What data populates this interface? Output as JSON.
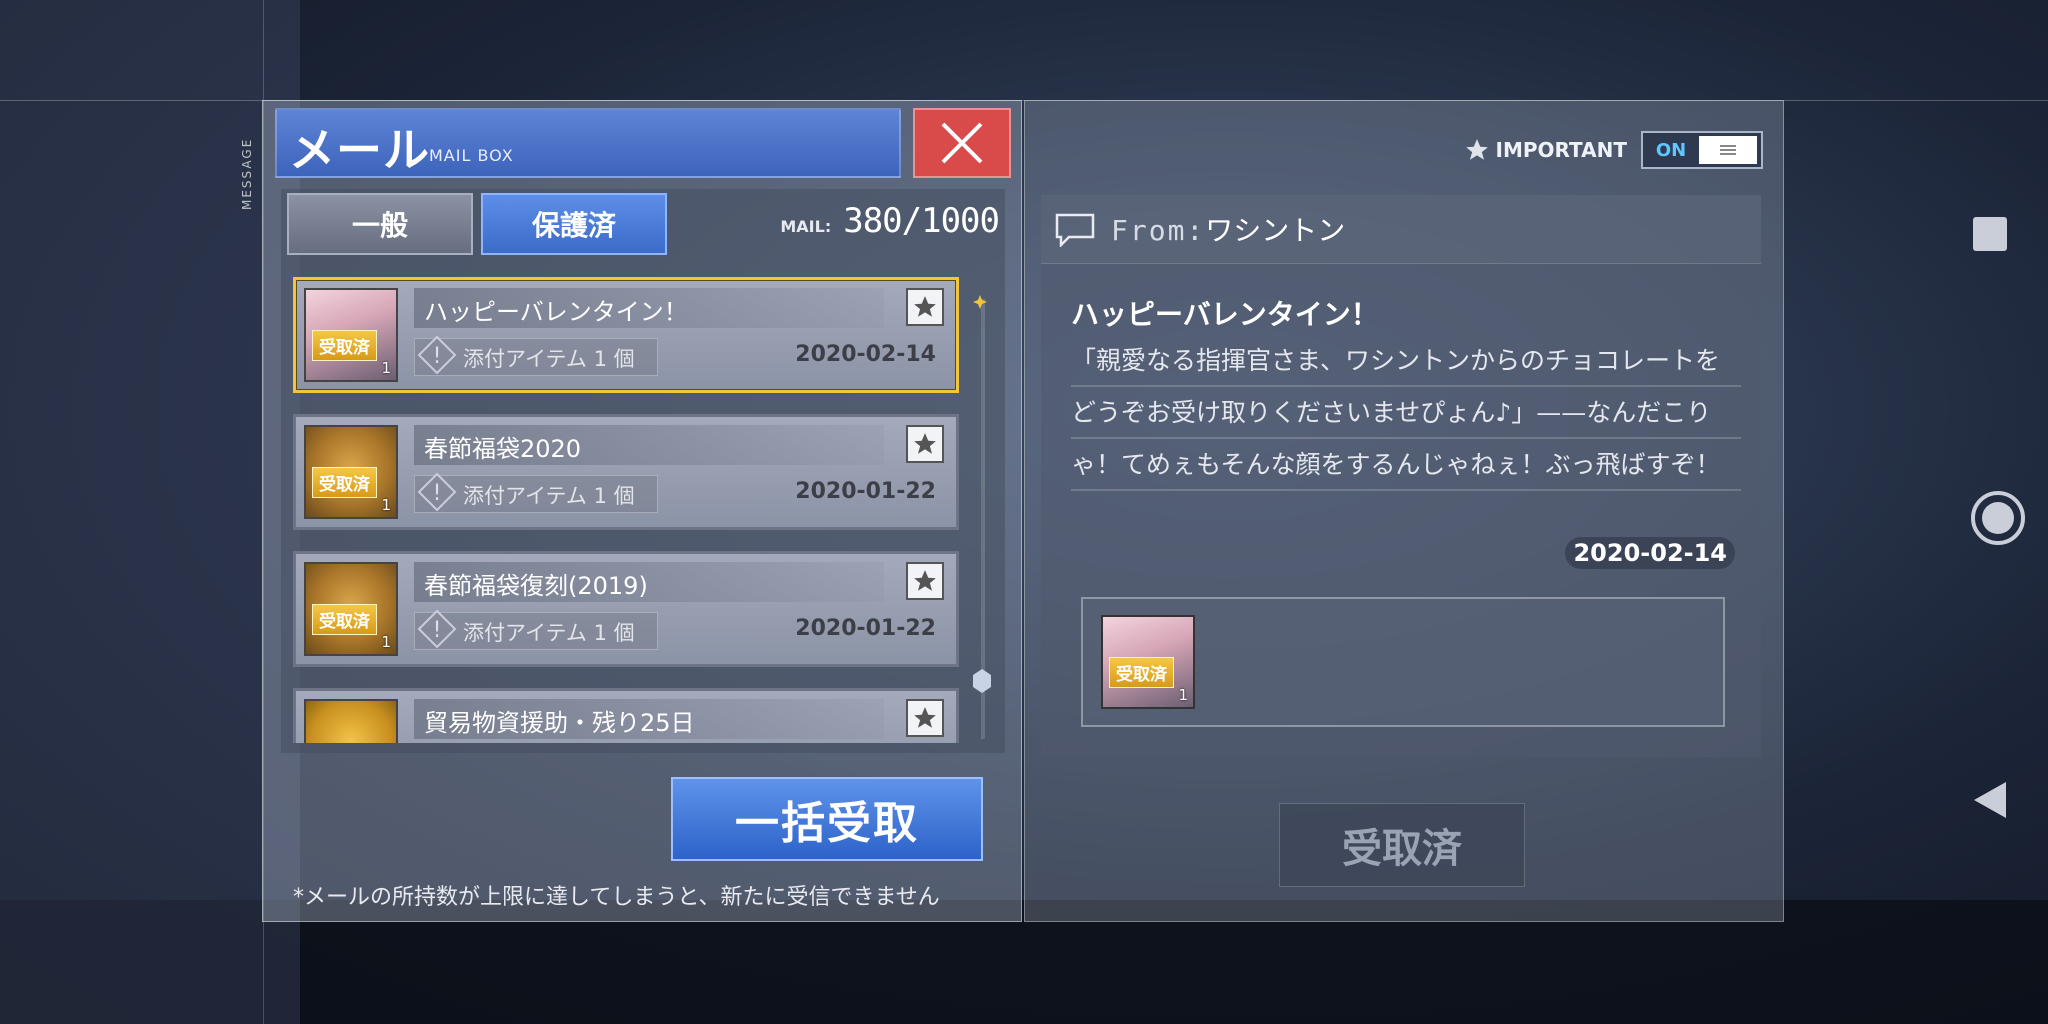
{
  "header": {
    "title": "メール",
    "subtitle": "MAIL BOX",
    "side_tag": "MESSAGE"
  },
  "tabs": [
    {
      "label": "一般",
      "active": false
    },
    {
      "label": "保護済",
      "active": true
    }
  ],
  "mail_counter": {
    "label": "MAIL:",
    "value": "380/1000"
  },
  "mail_list": [
    {
      "title": "ハッピーバレンタイン！",
      "badge": "受取済",
      "qty": "1",
      "attachment": "添付アイテム 1 個",
      "date": "2020-02-14",
      "selected": true,
      "icon": "character-thumbnail"
    },
    {
      "title": "春節福袋2020",
      "badge": "受取済",
      "qty": "1",
      "attachment": "添付アイテム 1 個",
      "date": "2020-01-22",
      "selected": false,
      "icon": "lucky-bag-thumbnail"
    },
    {
      "title": "春節福袋復刻(2019)",
      "badge": "受取済",
      "qty": "1",
      "attachment": "添付アイテム 1 個",
      "date": "2020-01-22",
      "selected": false,
      "icon": "lucky-bag-thumbnail"
    },
    {
      "title": "貿易物資援助・残り25日",
      "badge": "",
      "qty": "",
      "attachment": "",
      "date": "",
      "selected": false,
      "icon": "coin-thumbnail"
    }
  ],
  "claim_all_label": "一括受取",
  "footnote": "*メールの所持数が上限に達してしまうと、新たに受信できません",
  "important": {
    "label": "IMPORTANT",
    "toggle": "ON"
  },
  "detail": {
    "from_key": "From:",
    "from_name": "ワシントン",
    "title": "ハッピーバレンタイン！",
    "body": "「親愛なる指揮官さま、ワシントンからのチョコレートをどうぞお受け取りくださいませぴょん♪」——なんだこりゃ！てめぇもそんな顔をするんじゃねぇ！ぶっ飛ばすぞ！",
    "date": "2020-02-14",
    "attachment_badge": "受取済",
    "attachment_qty": "1",
    "received_label": "受取済"
  },
  "colors": {
    "accent_blue": "#3d64bb",
    "close_red": "#d94b4b",
    "gold": "#f2c53a"
  }
}
